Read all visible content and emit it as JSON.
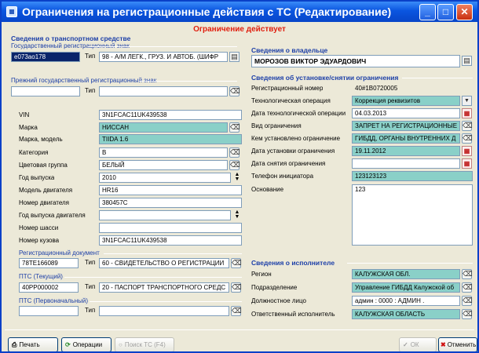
{
  "window": {
    "title": "Ограничения на регистрационные действия с ТС (Редактирование)"
  },
  "status": "Ограничение действует",
  "vehicle": {
    "section": "Сведения о транспортном средстве",
    "plate_group": "Государственный регистрационный знак",
    "plate_value": "е073ао178",
    "type_label": "Тип",
    "plate_type": "98 - А/М ЛЕГК., ГРУЗ. И АВТОБ. (ШИФР",
    "prev_plate_group": "Прежний государственный регистрационный знак",
    "prev_type_label": "Тип",
    "rows": [
      {
        "label": "VIN",
        "value": "3N1FCAC11UK439538"
      },
      {
        "label": "Марка",
        "value": "НИССАН"
      },
      {
        "label": "Марка, модель",
        "value": "TIIDA 1.6"
      },
      {
        "label": "Категория",
        "value": "B"
      },
      {
        "label": "Цветовая группа",
        "value": "БЕЛЫЙ"
      },
      {
        "label": "Год выпуска",
        "value": "2010"
      },
      {
        "label": "Модель двигателя",
        "value": "HR16"
      },
      {
        "label": "Номер двигателя",
        "value": "380457C"
      },
      {
        "label": "Год выпуска двигателя",
        "value": ""
      },
      {
        "label": "Номер шасси",
        "value": ""
      },
      {
        "label": "Номер кузова",
        "value": "3N1FCAC11UK439538"
      }
    ]
  },
  "docs": {
    "reg_group": "Регистрационный документ",
    "reg_num": "78ТЕ166089",
    "reg_type_label": "Тип",
    "reg_type": "60 - СВИДЕТЕЛЬСТВО О РЕГИСТРАЦИИ",
    "pts_cur_group": "ПТС (Текущий)",
    "pts_cur_num": "40РР000002",
    "pts_cur_type_label": "Тип",
    "pts_cur_type": "20 - ПАСПОРТ ТРАНСПОРТНОГО СРЕДС",
    "pts_first_group": "ПТС (Первоначальный)",
    "pts_first_type_label": "Тип"
  },
  "owner": {
    "section": "Сведения о владельце",
    "name": "МОРОЗОВ ВИКТОР ЭДУАРДОВИЧ"
  },
  "restriction": {
    "section": "Сведения об установке/снятии ограничения",
    "rows": [
      {
        "label": "Регистрационный номер",
        "value": "40#1В0720005"
      },
      {
        "label": "Технологическая операция",
        "value": "Коррекция реквизитов"
      },
      {
        "label": "Дата технологической операции",
        "value": "04.03.2013"
      },
      {
        "label": "Вид ограничения",
        "value": "ЗАПРЕТ НА РЕГИСТРАЦИОННЫЕ"
      },
      {
        "label": "Кем установлено ограничение",
        "value": "ГИБДД, ОРГАНЫ ВНУТРЕННИХ Д"
      },
      {
        "label": "Дата установки ограничения",
        "value": "19.11.2012"
      },
      {
        "label": "Дата снятия ограничения",
        "value": ""
      },
      {
        "label": "Телефон инициатора",
        "value": "123123123"
      },
      {
        "label": "Основание",
        "value": "123"
      }
    ]
  },
  "executor": {
    "section": "Сведения о исполнителе",
    "rows": [
      {
        "label": "Регион",
        "value": "КАЛУЖСКАЯ ОБЛ."
      },
      {
        "label": "Подразделение",
        "value": "Управление ГИБДД Калужской об"
      },
      {
        "label": "Должностное лицо",
        "value": "админ : 0000 : АДМИН ."
      },
      {
        "label": "Ответственный исполнитель",
        "value": "КАЛУЖСКАЯ ОБЛАСТЬ"
      }
    ]
  },
  "buttons": {
    "print": "Печать",
    "ops": "Операции",
    "search": "Поиск ТС (F4)",
    "ok": "ОК",
    "cancel": "Отменить"
  },
  "colors": {
    "title_bar": "#0a55e0",
    "status": "#e02010",
    "group_label": "#1c3fa8",
    "teal_field": "#8ad0c8"
  },
  "icons": {
    "lookup": "card-icon",
    "clear": "eraser-icon",
    "date": "calendar-icon",
    "dropdown": "chevron-down-icon",
    "spin": "spinner-icon"
  }
}
